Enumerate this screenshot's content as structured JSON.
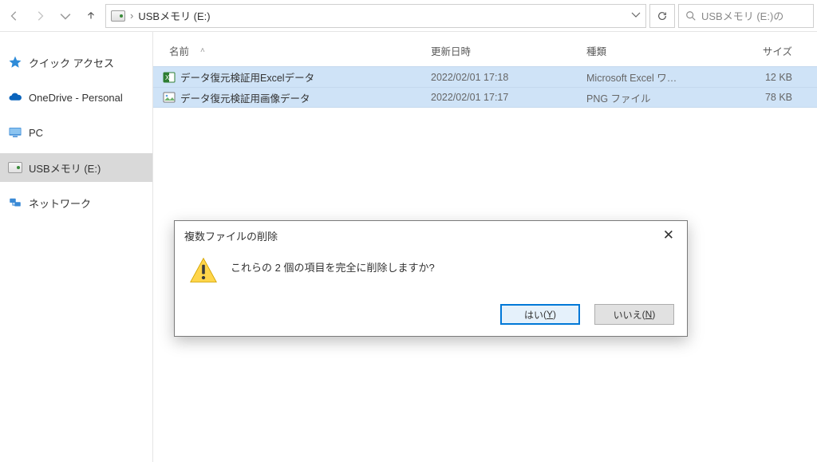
{
  "address_bar": {
    "location_label": "USBメモリ (E:)",
    "crumb_sep": "›"
  },
  "search": {
    "placeholder": "USBメモリ (E:)の"
  },
  "sidebar": {
    "items": [
      {
        "label": "クイック アクセス"
      },
      {
        "label": "OneDrive - Personal"
      },
      {
        "label": "PC"
      },
      {
        "label": "USBメモリ (E:)"
      },
      {
        "label": "ネットワーク"
      }
    ]
  },
  "columns": {
    "name": "名前",
    "date": "更新日時",
    "type": "種類",
    "size": "サイズ"
  },
  "files": [
    {
      "name": "データ復元検証用Excelデータ",
      "date": "2022/02/01 17:18",
      "type": "Microsoft Excel ワ…",
      "size": "12 KB",
      "icon": "excel"
    },
    {
      "name": "データ復元検証用画像データ",
      "date": "2022/02/01 17:17",
      "type": "PNG ファイル",
      "size": "78 KB",
      "icon": "image"
    }
  ],
  "dialog": {
    "title": "複数ファイルの削除",
    "message": "これらの 2 個の項目を完全に削除しますか?",
    "yes_label": "はい",
    "yes_m": "Y",
    "no_label": "いいえ",
    "no_m": "N"
  }
}
